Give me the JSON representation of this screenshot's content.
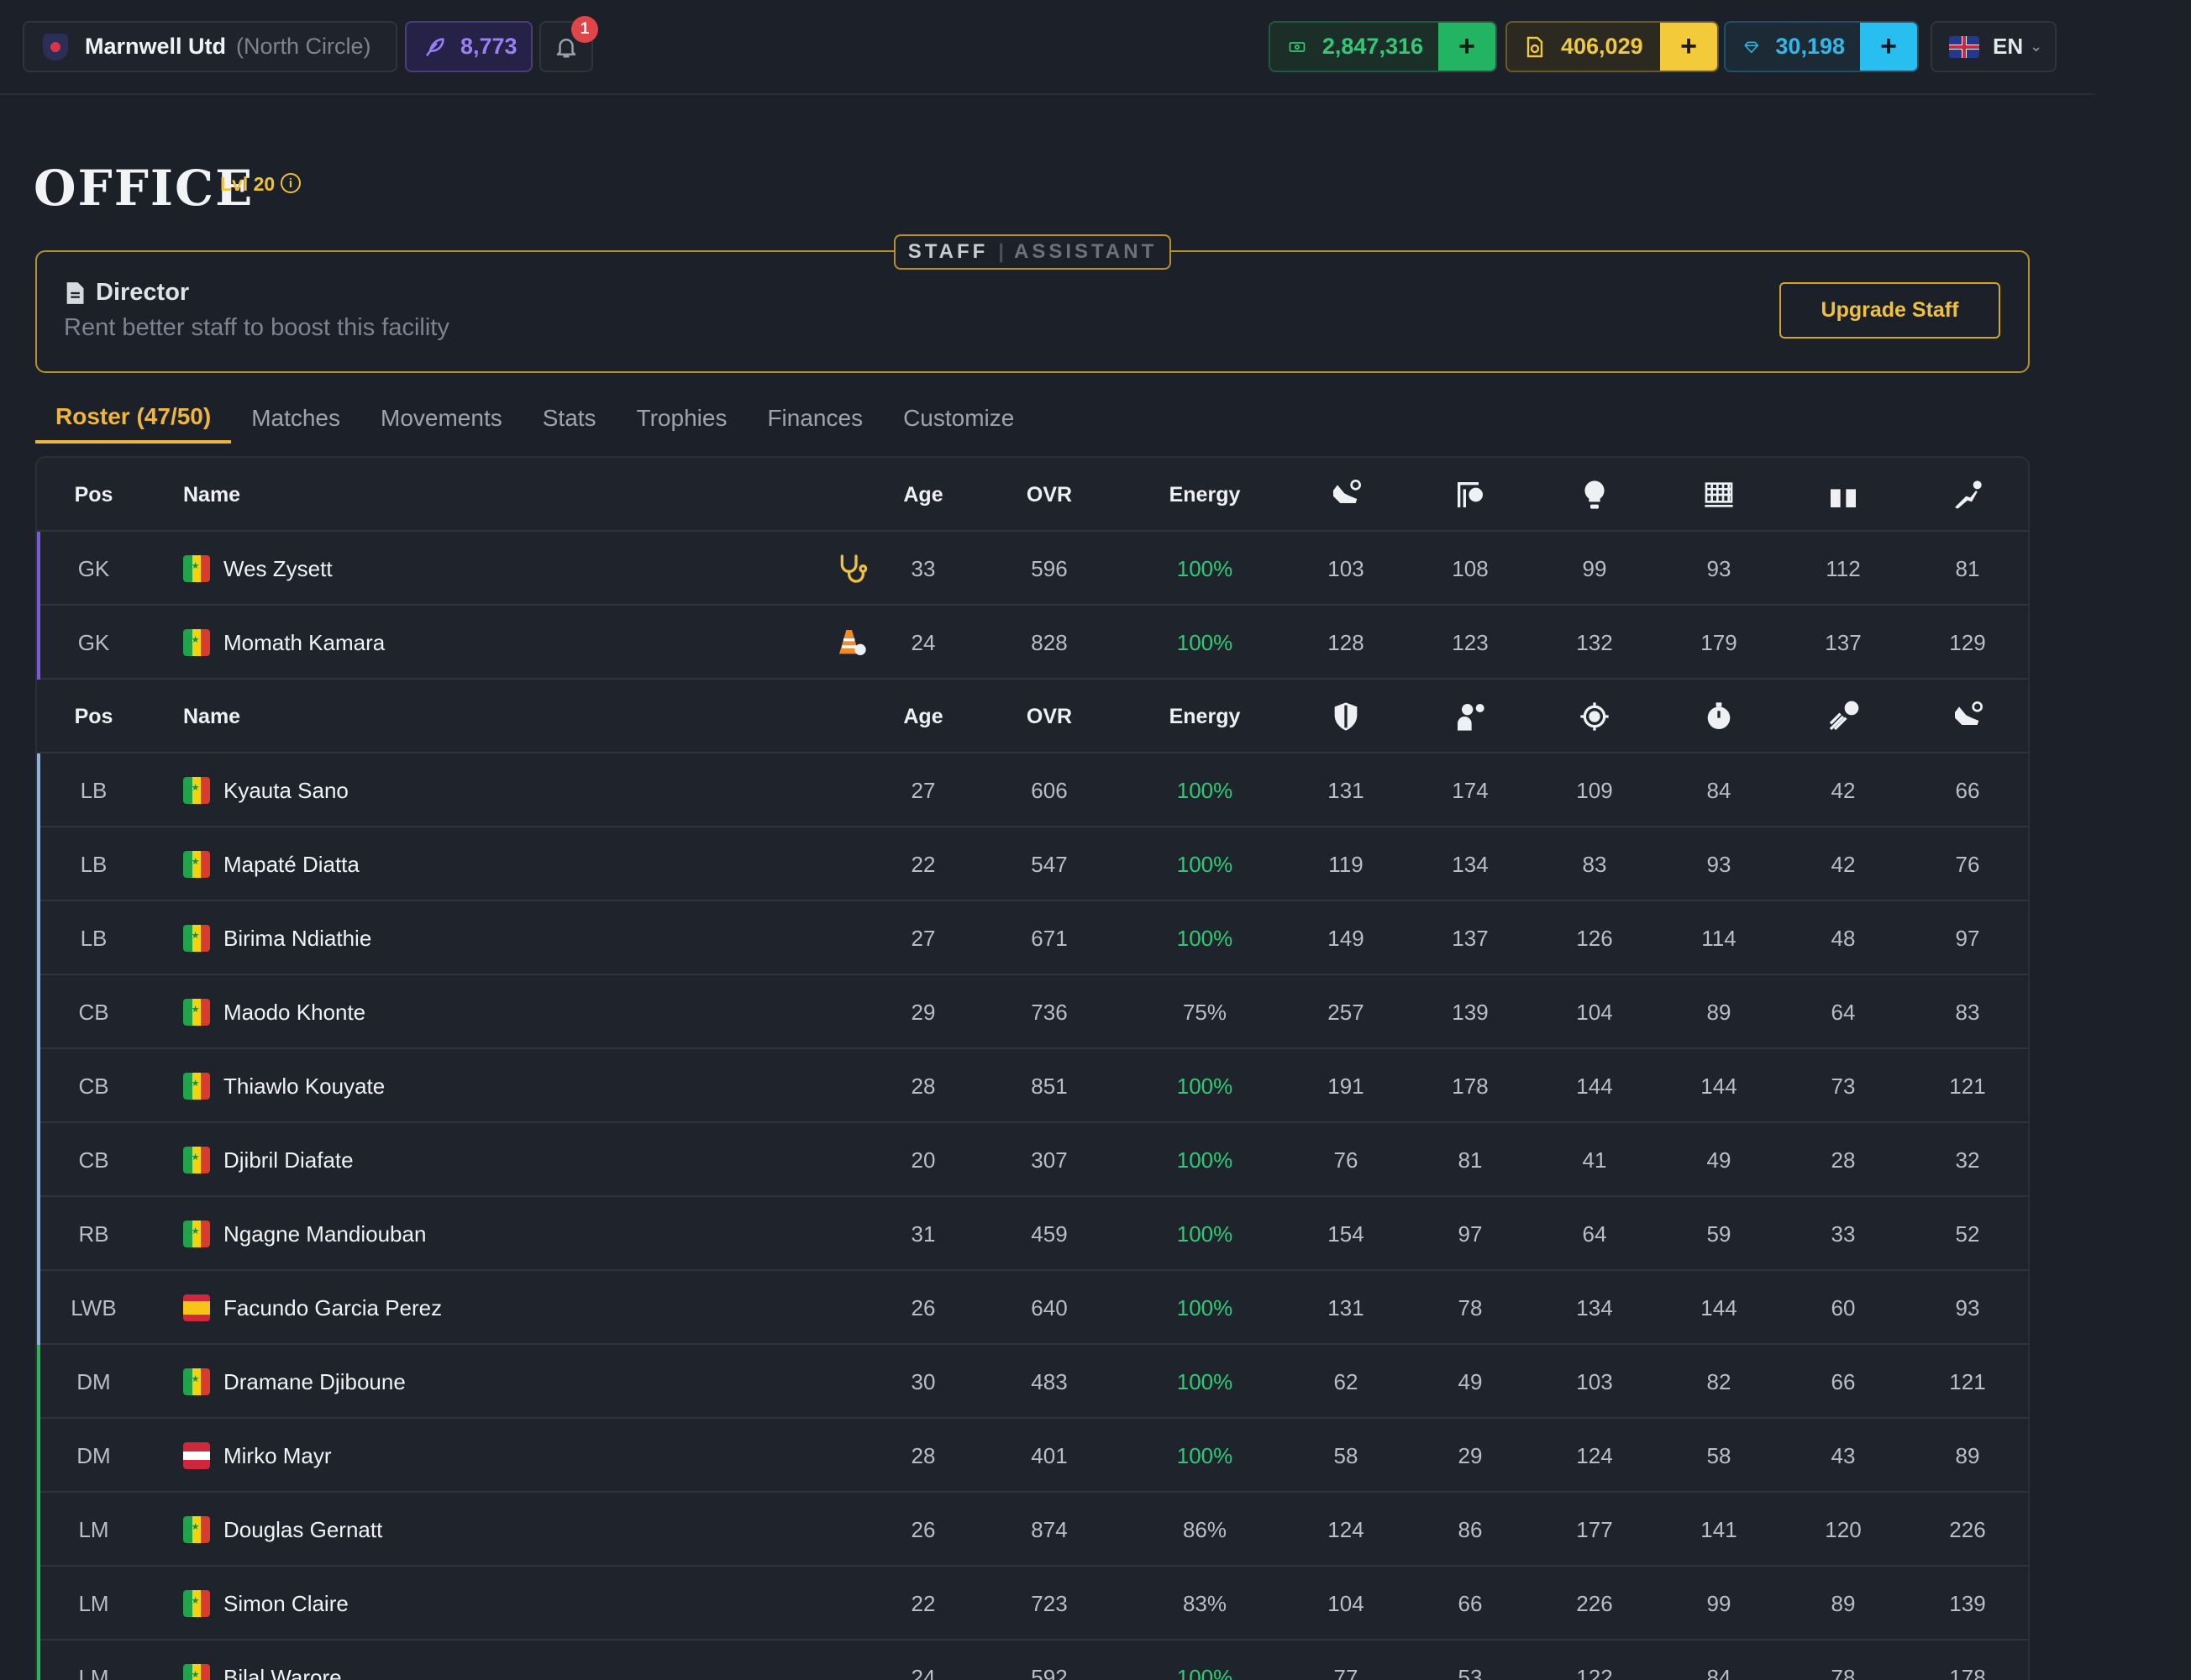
{
  "header": {
    "club_name": "Marnwell Utd",
    "club_region": "(North Circle)",
    "feathers": "8,773",
    "notifications": "1",
    "cash": "2,847,316",
    "coins": "406,029",
    "gems": "30,198",
    "plus_label": "+",
    "language": "EN"
  },
  "office": {
    "title": "OFFICE",
    "level": "Lvl 20",
    "info": "i"
  },
  "staff": {
    "toggle_on": "STAFF",
    "toggle_sep": "|",
    "toggle_off": "ASSISTANT",
    "role": "Director",
    "subtitle": "Rent better staff to boost this facility",
    "upgrade_label": "Upgrade Staff"
  },
  "tabs": [
    {
      "label": "Roster (47/50)"
    },
    {
      "label": "Matches"
    },
    {
      "label": "Movements"
    },
    {
      "label": "Stats"
    },
    {
      "label": "Trophies"
    },
    {
      "label": "Finances"
    },
    {
      "label": "Customize"
    }
  ],
  "table": {
    "col_pos": "Pos",
    "col_name": "Name",
    "col_age": "Age",
    "col_ovr": "OVR",
    "col_energy": "Energy",
    "gk_stat_icons": [
      "boot-icon",
      "goal-icon",
      "bulb-icon",
      "net-icon",
      "gloves-icon",
      "dive-icon"
    ],
    "field_stat_icons": [
      "shield-icon",
      "marking-icon",
      "target-icon",
      "stopwatch-icon",
      "shooting-icon",
      "boot-icon"
    ],
    "goalkeepers": [
      {
        "pos": "GK",
        "flag": "sn",
        "name": "Wes Zysett",
        "status": "stethoscope",
        "age": "33",
        "ovr": "596",
        "energy": "100%",
        "stats": [
          "103",
          "108",
          "99",
          "93",
          "112",
          "81"
        ]
      },
      {
        "pos": "GK",
        "flag": "sn",
        "name": "Momath Kamara",
        "status": "training-cone",
        "age": "24",
        "ovr": "828",
        "energy": "100%",
        "stats": [
          "128",
          "123",
          "132",
          "179",
          "137",
          "129"
        ]
      }
    ],
    "players": [
      {
        "pos": "LB",
        "flag": "sn",
        "group": "def",
        "name": "Kyauta Sano",
        "age": "27",
        "ovr": "606",
        "energy": "100%",
        "stats": [
          "131",
          "174",
          "109",
          "84",
          "42",
          "66"
        ]
      },
      {
        "pos": "LB",
        "flag": "sn",
        "group": "def",
        "name": "Mapaté Diatta",
        "age": "22",
        "ovr": "547",
        "energy": "100%",
        "stats": [
          "119",
          "134",
          "83",
          "93",
          "42",
          "76"
        ]
      },
      {
        "pos": "LB",
        "flag": "sn",
        "group": "def",
        "name": "Birima Ndiathie",
        "age": "27",
        "ovr": "671",
        "energy": "100%",
        "stats": [
          "149",
          "137",
          "126",
          "114",
          "48",
          "97"
        ]
      },
      {
        "pos": "CB",
        "flag": "sn",
        "group": "def",
        "name": "Maodo Khonte",
        "age": "29",
        "ovr": "736",
        "energy": "75%",
        "stats": [
          "257",
          "139",
          "104",
          "89",
          "64",
          "83"
        ]
      },
      {
        "pos": "CB",
        "flag": "sn",
        "group": "def",
        "name": "Thiawlo Kouyate",
        "age": "28",
        "ovr": "851",
        "energy": "100%",
        "stats": [
          "191",
          "178",
          "144",
          "144",
          "73",
          "121"
        ]
      },
      {
        "pos": "CB",
        "flag": "sn",
        "group": "def",
        "name": "Djibril Diafate",
        "age": "20",
        "ovr": "307",
        "energy": "100%",
        "stats": [
          "76",
          "81",
          "41",
          "49",
          "28",
          "32"
        ]
      },
      {
        "pos": "RB",
        "flag": "sn",
        "group": "def",
        "name": "Ngagne Mandiouban",
        "age": "31",
        "ovr": "459",
        "energy": "100%",
        "stats": [
          "154",
          "97",
          "64",
          "59",
          "33",
          "52"
        ]
      },
      {
        "pos": "LWB",
        "flag": "es",
        "group": "def",
        "name": "Facundo Garcia Perez",
        "age": "26",
        "ovr": "640",
        "energy": "100%",
        "stats": [
          "131",
          "78",
          "134",
          "144",
          "60",
          "93"
        ]
      },
      {
        "pos": "DM",
        "flag": "sn",
        "group": "mid",
        "name": "Dramane Djiboune",
        "age": "30",
        "ovr": "483",
        "energy": "100%",
        "stats": [
          "62",
          "49",
          "103",
          "82",
          "66",
          "121"
        ]
      },
      {
        "pos": "DM",
        "flag": "at",
        "group": "mid",
        "name": "Mirko Mayr",
        "age": "28",
        "ovr": "401",
        "energy": "100%",
        "stats": [
          "58",
          "29",
          "124",
          "58",
          "43",
          "89"
        ]
      },
      {
        "pos": "LM",
        "flag": "sn",
        "group": "mid",
        "name": "Douglas Gernatt",
        "age": "26",
        "ovr": "874",
        "energy": "86%",
        "stats": [
          "124",
          "86",
          "177",
          "141",
          "120",
          "226"
        ]
      },
      {
        "pos": "LM",
        "flag": "sn",
        "group": "mid",
        "name": "Simon Claire",
        "age": "22",
        "ovr": "723",
        "energy": "83%",
        "stats": [
          "104",
          "66",
          "226",
          "99",
          "89",
          "139"
        ]
      },
      {
        "pos": "LM",
        "flag": "sn",
        "group": "mid",
        "name": "Bilal Warore",
        "age": "24",
        "ovr": "592",
        "energy": "100%",
        "stats": [
          "77",
          "53",
          "122",
          "84",
          "78",
          "178"
        ]
      }
    ]
  },
  "colors": {
    "gk_bar": "#7b5cd6",
    "def_bar": "#8fb3d9",
    "mid_bar": "#2fb35a",
    "energy_full": "#2fca75",
    "accent": "#f0b63a"
  }
}
